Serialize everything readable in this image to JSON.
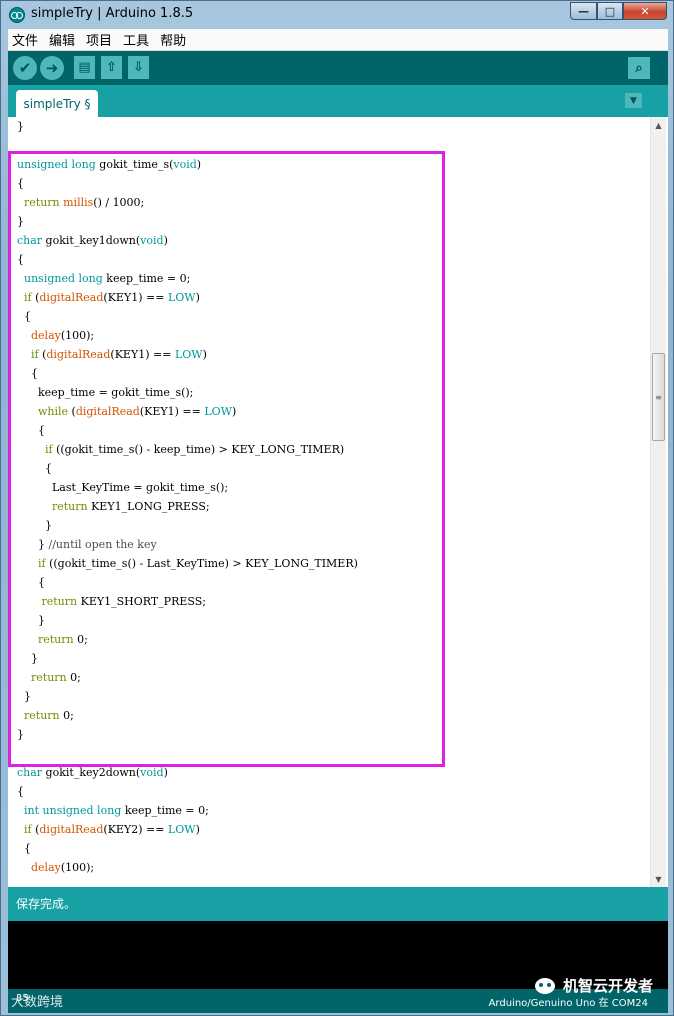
{
  "window": {
    "title": "simpleTry | Arduino 1.8.5",
    "controls": {
      "minimize": "—",
      "maximize": "□",
      "close": "✕"
    }
  },
  "menu": [
    "文件",
    "编辑",
    "项目",
    "工具",
    "帮助"
  ],
  "toolbar": {
    "verify_icon": "✔",
    "upload_icon": "➜",
    "new_icon": "▤",
    "open_icon": "⇧",
    "save_icon": "⇩",
    "serial_icon": "⌕"
  },
  "tabs": [
    {
      "label": "simpleTry §"
    }
  ],
  "tab_menu_icon": "▼",
  "editor": {
    "lines": [
      [
        [
          "t",
          "}"
        ]
      ],
      [
        [
          "t",
          ""
        ]
      ],
      [
        [
          "type",
          "unsigned"
        ],
        [
          "t",
          " "
        ],
        [
          "type",
          "long"
        ],
        [
          "t",
          " gokit_time_s("
        ],
        [
          "type",
          "void"
        ],
        [
          "t",
          ")"
        ]
      ],
      [
        [
          "t",
          "{"
        ]
      ],
      [
        [
          "t",
          "  "
        ],
        [
          "ctrl",
          "return"
        ],
        [
          "t",
          " "
        ],
        [
          "fn",
          "millis"
        ],
        [
          "t",
          "() / 1000;"
        ]
      ],
      [
        [
          "t",
          "}"
        ]
      ],
      [
        [
          "type",
          "char"
        ],
        [
          "t",
          " gokit_key1down("
        ],
        [
          "type",
          "void"
        ],
        [
          "t",
          ")"
        ]
      ],
      [
        [
          "t",
          "{"
        ]
      ],
      [
        [
          "t",
          "  "
        ],
        [
          "type",
          "unsigned"
        ],
        [
          "t",
          " "
        ],
        [
          "type",
          "long"
        ],
        [
          "t",
          " keep_time = 0;"
        ]
      ],
      [
        [
          "t",
          "  "
        ],
        [
          "ctrl",
          "if"
        ],
        [
          "t",
          " ("
        ],
        [
          "fn",
          "digitalRead"
        ],
        [
          "t",
          "(KEY1) == "
        ],
        [
          "const",
          "LOW"
        ],
        [
          "t",
          ")"
        ]
      ],
      [
        [
          "t",
          "  {"
        ]
      ],
      [
        [
          "t",
          "    "
        ],
        [
          "fn",
          "delay"
        ],
        [
          "t",
          "(100);"
        ]
      ],
      [
        [
          "t",
          "    "
        ],
        [
          "ctrl",
          "if"
        ],
        [
          "t",
          " ("
        ],
        [
          "fn",
          "digitalRead"
        ],
        [
          "t",
          "(KEY1) == "
        ],
        [
          "const",
          "LOW"
        ],
        [
          "t",
          ")"
        ]
      ],
      [
        [
          "t",
          "    {"
        ]
      ],
      [
        [
          "t",
          "      keep_time = gokit_time_s();"
        ]
      ],
      [
        [
          "t",
          "      "
        ],
        [
          "ctrl",
          "while"
        ],
        [
          "t",
          " ("
        ],
        [
          "fn",
          "digitalRead"
        ],
        [
          "t",
          "(KEY1) == "
        ],
        [
          "const",
          "LOW"
        ],
        [
          "t",
          ")"
        ]
      ],
      [
        [
          "t",
          "      {"
        ]
      ],
      [
        [
          "t",
          "        "
        ],
        [
          "ctrl",
          "if"
        ],
        [
          "t",
          " ((gokit_time_s() - keep_time) > KEY_LONG_TIMER)"
        ]
      ],
      [
        [
          "t",
          "        {"
        ]
      ],
      [
        [
          "t",
          "          Last_KeyTime = gokit_time_s();"
        ]
      ],
      [
        [
          "t",
          "          "
        ],
        [
          "ctrl",
          "return"
        ],
        [
          "t",
          " KEY1_LONG_PRESS;"
        ]
      ],
      [
        [
          "t",
          "        }"
        ]
      ],
      [
        [
          "t",
          "      } "
        ],
        [
          "comment",
          "//until open the key"
        ]
      ],
      [
        [
          "t",
          "      "
        ],
        [
          "ctrl",
          "if"
        ],
        [
          "t",
          " ((gokit_time_s() - Last_KeyTime) > KEY_LONG_TIMER)"
        ]
      ],
      [
        [
          "t",
          "      {"
        ]
      ],
      [
        [
          "t",
          "       "
        ],
        [
          "ctrl",
          "return"
        ],
        [
          "t",
          " KEY1_SHORT_PRESS;"
        ]
      ],
      [
        [
          "t",
          "      }"
        ]
      ],
      [
        [
          "t",
          "      "
        ],
        [
          "ctrl",
          "return"
        ],
        [
          "t",
          " 0;"
        ]
      ],
      [
        [
          "t",
          "    }"
        ]
      ],
      [
        [
          "t",
          "    "
        ],
        [
          "ctrl",
          "return"
        ],
        [
          "t",
          " 0;"
        ]
      ],
      [
        [
          "t",
          "  }"
        ]
      ],
      [
        [
          "t",
          "  "
        ],
        [
          "ctrl",
          "return"
        ],
        [
          "t",
          " 0;"
        ]
      ],
      [
        [
          "t",
          "}"
        ]
      ],
      [
        [
          "t",
          ""
        ]
      ],
      [
        [
          "type",
          "char"
        ],
        [
          "t",
          " gokit_key2down("
        ],
        [
          "type",
          "void"
        ],
        [
          "t",
          ")"
        ]
      ],
      [
        [
          "t",
          "{"
        ]
      ],
      [
        [
          "t",
          "  "
        ],
        [
          "type",
          "int"
        ],
        [
          "t",
          " "
        ],
        [
          "type",
          "unsigned"
        ],
        [
          "t",
          " "
        ],
        [
          "type",
          "long"
        ],
        [
          "t",
          " keep_time = 0;"
        ]
      ],
      [
        [
          "t",
          "  "
        ],
        [
          "ctrl",
          "if"
        ],
        [
          "t",
          " ("
        ],
        [
          "fn",
          "digitalRead"
        ],
        [
          "t",
          "(KEY2) == "
        ],
        [
          "const",
          "LOW"
        ],
        [
          "t",
          ")"
        ]
      ],
      [
        [
          "t",
          "  {"
        ]
      ],
      [
        [
          "t",
          "    "
        ],
        [
          "fn",
          "delay"
        ],
        [
          "t",
          "(100);"
        ]
      ]
    ],
    "scrollbar": {
      "up_icon": "▲",
      "down_icon": "▼",
      "thumb_grip": "≡"
    },
    "highlight_color": "#e020e0"
  },
  "status": {
    "message": "保存完成。"
  },
  "bottom": {
    "line_number": "35",
    "board_info": "Arduino/Genuino Uno 在 COM24"
  },
  "watermarks": {
    "left": "大数跨境",
    "right": "机智云开发者"
  },
  "colors": {
    "toolbar_bg": "#006468",
    "tabstrip_bg": "#17a1a5",
    "button_fill": "#4db7bb",
    "keyword_type": "#00979c",
    "keyword_function": "#d35400",
    "keyword_control": "#728e00"
  }
}
